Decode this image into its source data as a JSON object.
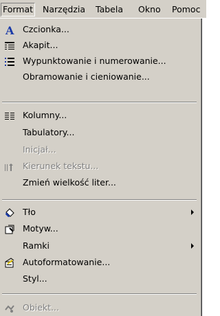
{
  "menubar": {
    "items": [
      "Format",
      "Narzędzia",
      "Tabela",
      "Okno",
      "Pomoc"
    ]
  },
  "menu": {
    "items": [
      {
        "label": "Czcionka...",
        "icon": "font-icon",
        "enabled": true
      },
      {
        "label": "Akapit...",
        "icon": "paragraph-icon",
        "enabled": true
      },
      {
        "label": "Wypunktowanie i numerowanie...",
        "icon": "bullets-icon",
        "enabled": true
      },
      {
        "label": "Obramowanie i cieniowanie...",
        "icon": "",
        "enabled": true
      },
      {
        "label": "Kolumny...",
        "icon": "columns-icon",
        "enabled": true
      },
      {
        "label": "Tabulatory...",
        "icon": "",
        "enabled": true
      },
      {
        "label": "Inicjał...",
        "icon": "",
        "enabled": false
      },
      {
        "label": "Kierunek tekstu...",
        "icon": "text-direction-icon",
        "enabled": false
      },
      {
        "label": "Zmień wielkość liter...",
        "icon": "",
        "enabled": true
      },
      {
        "label": "Tło",
        "icon": "fill-bucket-icon",
        "enabled": true,
        "submenu": true
      },
      {
        "label": "Motyw...",
        "icon": "theme-icon",
        "enabled": true
      },
      {
        "label": "Ramki",
        "icon": "",
        "enabled": true,
        "submenu": true
      },
      {
        "label": "Autoformatowanie...",
        "icon": "autoformat-icon",
        "enabled": true
      },
      {
        "label": "Styl...",
        "icon": "",
        "enabled": true
      },
      {
        "label": "Obiekt...",
        "icon": "object-icon",
        "enabled": false
      }
    ]
  }
}
